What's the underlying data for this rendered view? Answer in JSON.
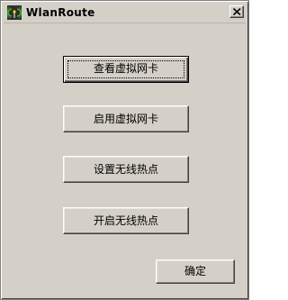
{
  "window": {
    "title": "WlanRoute",
    "app_icon": "wireless-antenna-icon",
    "close_icon": "close-icon"
  },
  "buttons": {
    "view_virtual_nic": "查看虚拟网卡",
    "enable_virtual_nic": "启用虚拟网卡",
    "setup_hotspot": "设置无线热点",
    "start_hotspot": "开启无线热点",
    "ok": "确定"
  },
  "colors": {
    "face": "#d4d0c8",
    "text": "#000000",
    "icon_green": "#3a8a2a"
  }
}
